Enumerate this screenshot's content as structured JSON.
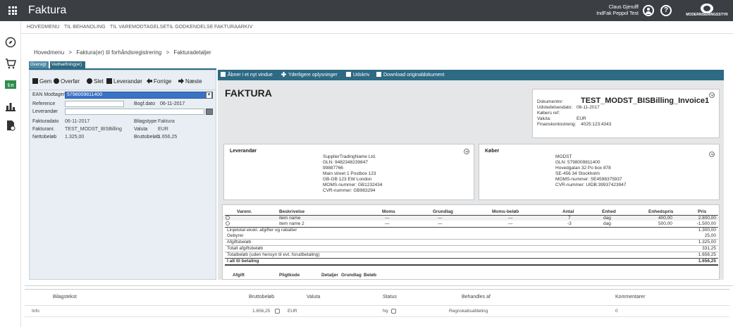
{
  "topbar": {
    "app_title": "Faktura",
    "user_name": "Claus Gjerulff",
    "user_org": "IndFak Peppol Test",
    "logo_text": "MODERNISERINGSSTYR"
  },
  "menu": {
    "items": [
      "HOVEDMENU",
      "TIL BEHANDLING",
      "TIL VAREMODTAGELSE",
      "TIL GODKENDELSE",
      "FAKTURAARKIV"
    ]
  },
  "breadcrumb": {
    "items": [
      "Hovedmenu",
      "Faktura(er) til forhåndsregistrering",
      "Fakturadetaljer"
    ],
    "separator": ">"
  },
  "tabs": [
    {
      "label": "Oversigt"
    },
    {
      "label": "Vedhæftning(er)"
    }
  ],
  "left_toolbar": {
    "save": "Gem",
    "transfer": "Overfør",
    "delete": "Slet",
    "supplier": "Leverandør",
    "previous": "Forrige",
    "next": "Næste"
  },
  "fields": {
    "ean_label": "EAN Modtager",
    "ean_value": "5798009811400",
    "reference_label": "Reference",
    "booking_date_label": "Bogf.dato",
    "booking_date_value": "06-11-2017",
    "supplier_label": "Leverandør",
    "invoice_date_label": "Fakturadato",
    "invoice_date_value": "06-11-2017",
    "doc_type_label": "Bilagstype",
    "doc_type_value": "Faktura",
    "invoice_no_label": "Fakturanr.",
    "invoice_no_value": "TEST_MODST_BISBilling",
    "currency_label": "Valuta",
    "currency_value": "EUR",
    "net_label": "Nettobeløb",
    "net_value": "1.325,00",
    "gross_label": "Bruttobeløb",
    "gross_value": "1.656,25"
  },
  "right_toolbar": {
    "open_new": "Åbner i et nyt vindue",
    "more_info": "Yderligere oplysninger",
    "print": "Udskriv",
    "download": "Download originaldokument"
  },
  "document": {
    "title": "FAKTURA",
    "info": {
      "docno_label": "Dokumentnr:",
      "docno_value": "TEST_MODST_BISBilling_Invoice1",
      "issue_label": "Udstedelsesdato:",
      "issue_value": "06-11-2017",
      "buyer_ref_label": "Købers ref:",
      "currency_label": "Valuta:",
      "currency_value": "EUR",
      "account_label": "Finanskontostreng:",
      "account_value": "4025:123:4343"
    },
    "supplier": {
      "heading": "Leverandør",
      "lines": [
        "SupplierTradingName Ltd.",
        "GLN: 9482348239847",
        "99887766",
        "Main street 1 Postbox 123",
        "GB-GB 123 EW London",
        "MOMS-nummer: GB1232434",
        "CVR-nummer:   GB983294"
      ]
    },
    "buyer": {
      "heading": "Køber",
      "lines": [
        "MODST",
        "GLN: 5798009811400",
        "Hovedgatan 32 Po box 878",
        "SE-456 34 Stockholm",
        "MOMS-nummer: SE4598375937",
        "CVR-nummer:   UIDB:39937423947"
      ]
    },
    "lines_table": {
      "headers": [
        "Varenr.",
        "Beskrivelse",
        "Moms",
        "Grundlag",
        "Moms-beløb",
        "Antal",
        "Enhed",
        "Enhedspris",
        "Pris"
      ],
      "rows": [
        {
          "desc": "item name",
          "moms": "—",
          "grundlag": "—",
          "momsbelob": "—",
          "antal": "7",
          "enhed": "dag",
          "enhedspris": "400,00",
          "pris": "2.800,00"
        },
        {
          "desc": "item name 2",
          "moms": "—",
          "grundlag": "—",
          "momsbelob": "—",
          "antal": "-3",
          "enhed": "dag",
          "enhedspris": "500,00",
          "pris": "-1.500,00"
        }
      ],
      "summary": [
        {
          "label": "Linjetotal ekskl. afgifter og rabatter",
          "value": "1.300,00"
        },
        {
          "label": "Gebyrer",
          "value": "25,00"
        },
        {
          "label": "Afgiftsbeløb",
          "value": "1.325,00"
        },
        {
          "label": "Totalt afgiftsbeløb",
          "value": "331,25"
        },
        {
          "label": "Totalbeløb (uden hensyn til evt. forudbetaling)",
          "value": "1.656,25"
        },
        {
          "label": "I alt til betaling",
          "value": "1.656,25"
        }
      ],
      "tax_headers": [
        "Afgift",
        "Pligtkode",
        "Detaljer",
        "Grundlag",
        "Beløb"
      ]
    }
  },
  "bottom_grid": {
    "headers": [
      "Bilagstekst",
      "Bruttobeløb",
      "Valuta",
      "Status",
      "Behandles af",
      "Kommentarer"
    ],
    "row": {
      "text": "Info",
      "gross": "1.656,25",
      "currency": "EUR",
      "status": "Ny",
      "handler": "Regnskabsafdeling",
      "comments": "0"
    }
  },
  "colors": {
    "topbar": "#3b3f44",
    "accent": "#2d6a84",
    "selection": "#3a72c4"
  }
}
